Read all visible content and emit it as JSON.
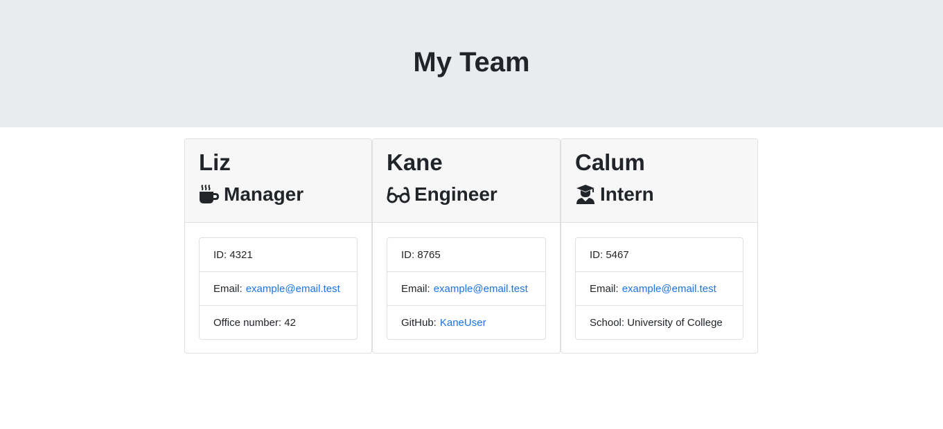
{
  "header": {
    "title": "My Team"
  },
  "team": [
    {
      "name": "Liz",
      "role": "Manager",
      "icon": "coffee-icon",
      "details": {
        "id_label": "ID: 4321",
        "email_label": "Email:",
        "email": "example@email.test",
        "extra_label": "Office number: 42"
      }
    },
    {
      "name": "Kane",
      "role": "Engineer",
      "icon": "glasses-icon",
      "details": {
        "id_label": "ID: 8765",
        "email_label": "Email:",
        "email": "example@email.test",
        "extra_label": "GitHub:",
        "extra_link": "KaneUser"
      }
    },
    {
      "name": "Calum",
      "role": "Intern",
      "icon": "graduate-icon",
      "details": {
        "id_label": "ID: 5467",
        "email_label": "Email:",
        "email": "example@email.test",
        "extra_label": "School: University of College"
      }
    }
  ],
  "colors": {
    "header_bg": "#e9ecef",
    "card_header_bg": "#f7f7f7",
    "link": "#1a73e8"
  }
}
